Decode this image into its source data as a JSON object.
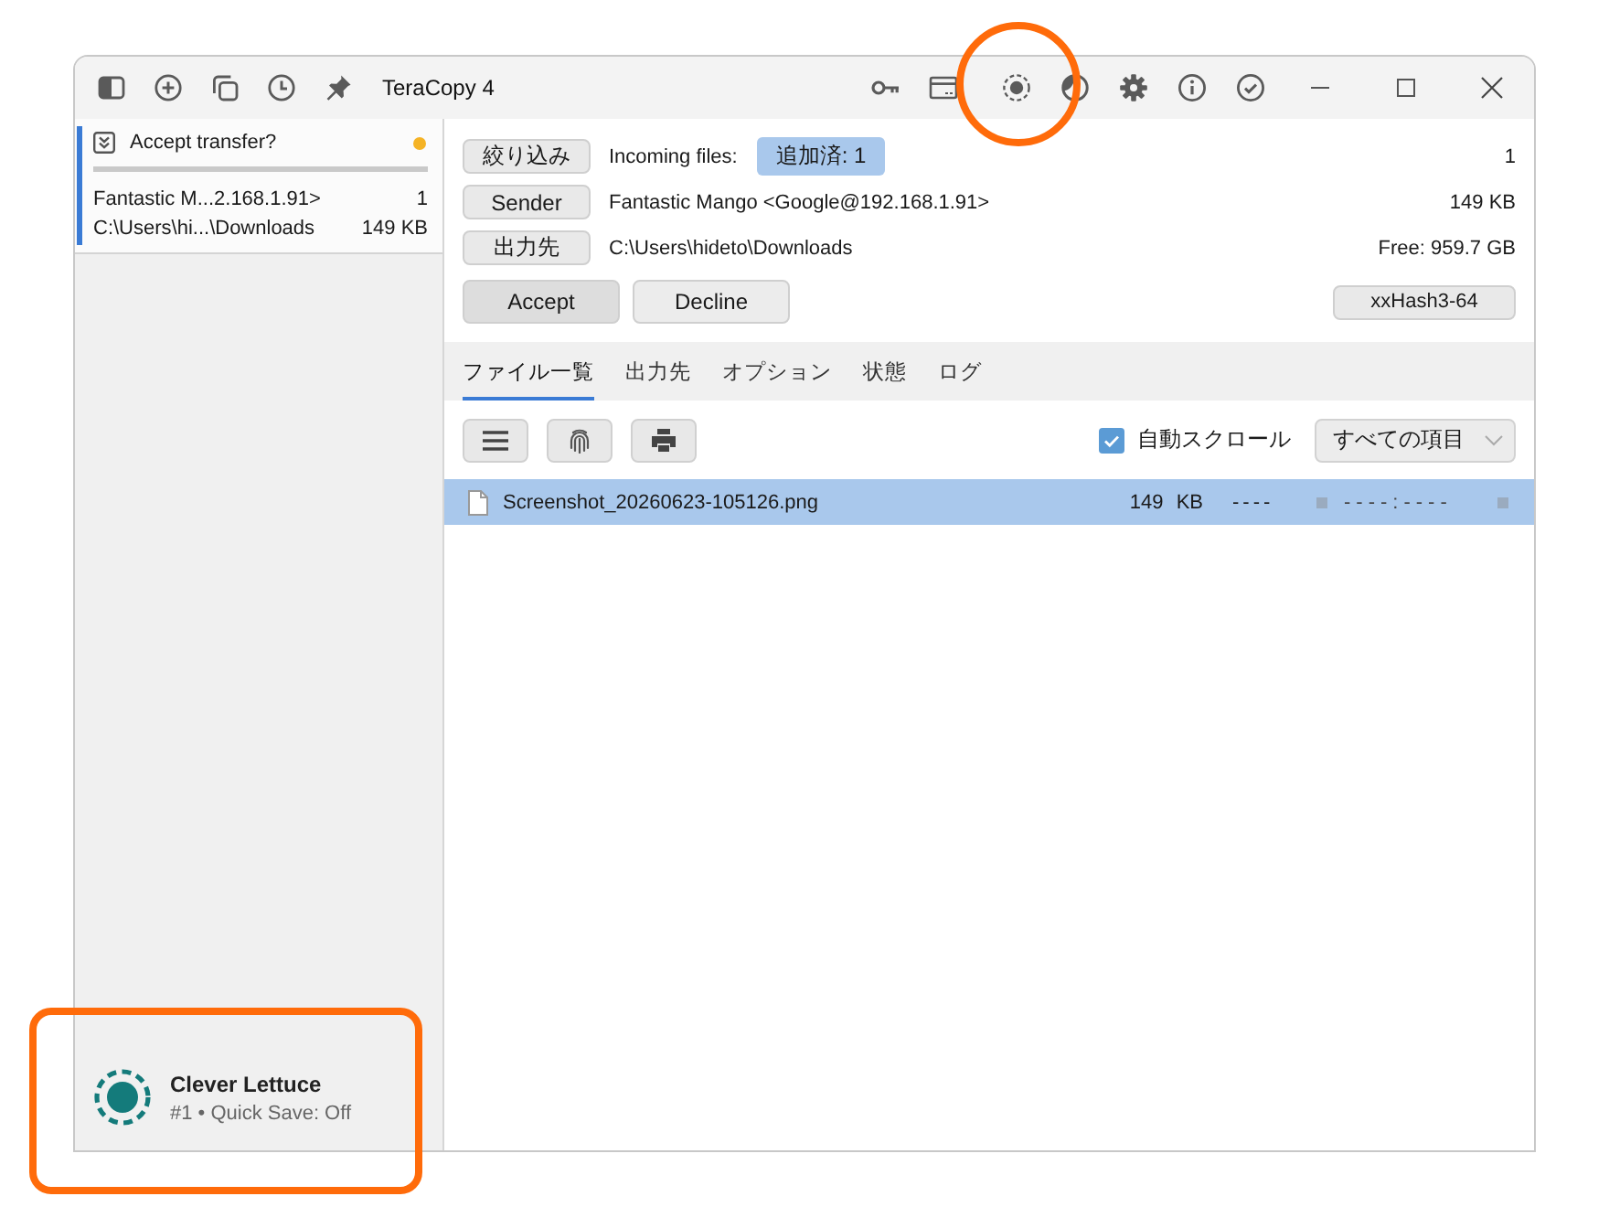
{
  "window": {
    "title": "TeraCopy 4"
  },
  "sidebar": {
    "transfers": [
      {
        "title": "Accept transfer?",
        "selected": true,
        "color": "#f5b325",
        "level": 0,
        "sender": "Fantastic M...2.168.1.91>",
        "count": "1",
        "path": "C:\\Users\\hi...\\Downloads",
        "size": "149 KB"
      }
    ],
    "profile": {
      "name": "Clever Lettuce",
      "detail": "#1 • Quick Save: Off"
    }
  },
  "transfer": {
    "rows": [
      {
        "button": "絞り込み",
        "label": "Incoming files:",
        "badge": "追加済: 1",
        "value": "1"
      },
      {
        "button": "Sender",
        "label": "Fantastic Mango <Google@192.168.1.91>",
        "value": "149 KB"
      },
      {
        "button": "出力先",
        "label": "C:\\Users\\hideto\\Downloads",
        "value": "Free: 959.7 GB"
      }
    ],
    "actions": [
      {
        "label": "Accept",
        "default": true
      },
      {
        "label": "Decline",
        "default": false
      }
    ],
    "hash_button": "xxHash3-64"
  },
  "tabs": [
    {
      "label": "ファイル一覧",
      "selected": true
    },
    {
      "label": "出力先",
      "selected": false
    },
    {
      "label": "オプション",
      "selected": false
    },
    {
      "label": "状態",
      "selected": false
    },
    {
      "label": "ログ",
      "selected": false
    }
  ],
  "toolbar": {
    "auto_scroll": {
      "label": "自動スクロール",
      "checked": true
    },
    "filter": {
      "value": "すべての項目"
    }
  },
  "files": [
    {
      "name": "Screenshot_20260623-105126.png",
      "size": "149 KB",
      "column_3": "----",
      "column_4": "----:----",
      "selected": true
    }
  ],
  "highlights": [
    {
      "kind": "circle"
    },
    {
      "kind": "frame"
    }
  ]
}
